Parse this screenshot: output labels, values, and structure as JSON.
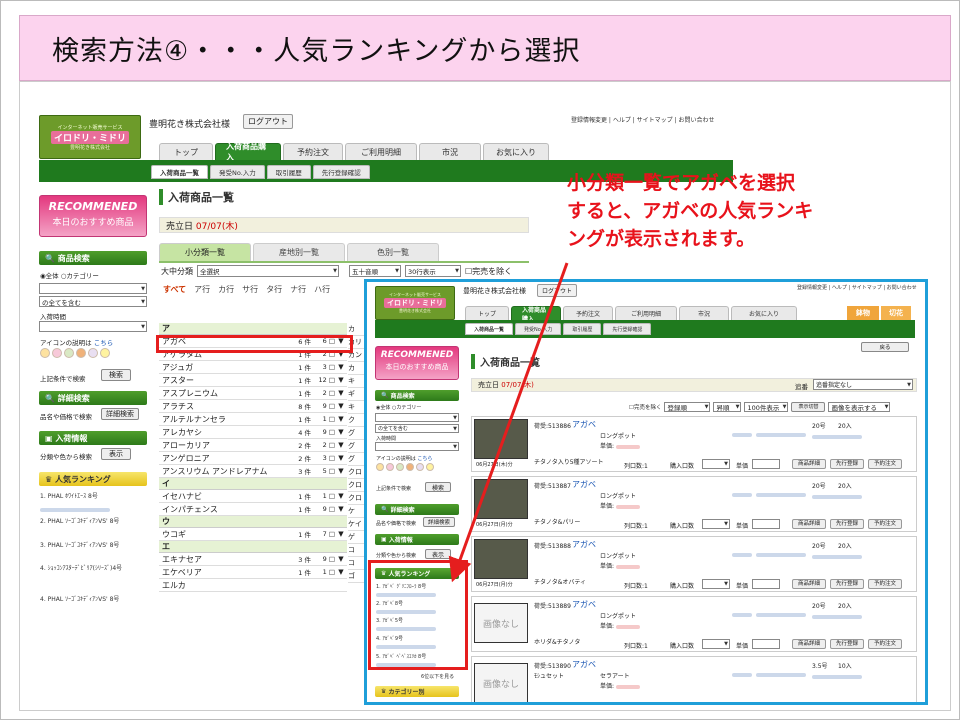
{
  "slide": {
    "title": "検索方法④・・・人気ランキングから選択"
  },
  "callout": {
    "text": "小分類一覧でアガベを選択\nすると、アガベの人気ランキ\nングが表示されます。"
  },
  "shot1": {
    "logo": {
      "line1": "インターネット販売サービス",
      "line2": "イロドリ・ミドリ",
      "line3": "豊明花き株式会社"
    },
    "company": "豊明花き株式会社様",
    "logout": "ログアウト",
    "toplinks": "登録情報変更 | ヘルプ | サイトマップ | お問い合わせ",
    "tabs": [
      "トップ",
      "入荷商品購入",
      "予約注文",
      "ご利用明細",
      "市況",
      "お気に入り"
    ],
    "subtabs": [
      "入荷商品一覧",
      "発受No.入力",
      "取引履歴",
      "先行登録確認"
    ],
    "recommend": {
      "title": "RECOMMENED",
      "sub": "本日のおすすめ商品"
    },
    "search": {
      "header": "商品検索",
      "radio_all": "全体",
      "radio_cat": "カテゴリー",
      "contains": "の全てを含む",
      "time_label": "入荷時間",
      "icon_help": "アイコンの説明は",
      "icon_help_link": "こちら",
      "search_label": "上記条件で検索",
      "search_btn": "検索"
    },
    "detail": {
      "header": "詳細検索",
      "label": "品名や価格で検索",
      "btn": "詳細検索"
    },
    "arrival": {
      "header": "入荷情報",
      "label": "分類や色から検索",
      "btn": "表示"
    },
    "ranking": {
      "header": "人気ランキング",
      "items": [
        "1. PHAL ﾎﾜｲﾄｴｰｽ 8号",
        "2. PHAL ｿｰｺﾞﾕｷﾃﾞｨｱﾝVS' 8号",
        "3. PHAL ｿｰｺﾞﾕｷﾃﾞｨｱﾝVS' 8号",
        "4. ｼｮｯｺﾝｱｽﾀｰﾃﾞﾋﾞﾘｱ(ｼﾘｰｽﾞ)4号",
        "4. PHAL ｿｰｺﾞﾕｷﾃﾞｨｱﾝVS' 8号"
      ]
    },
    "main": {
      "heading": "入荷商品一覧",
      "date_label": "売立日",
      "date_value": "07/07(木)",
      "inner_tabs": [
        "小分類一覧",
        "産地別一覧",
        "色別一覧"
      ],
      "filter_label": "大中分類",
      "filter_value": "全選択",
      "sort_value": "五十音順",
      "rows_value": "30行表示",
      "sold_out": "完売を除く",
      "kana": [
        "すべて",
        "ア行",
        "カ行",
        "サ行",
        "タ行",
        "ナ行",
        "ハ行"
      ],
      "groups": [
        {
          "head": "ア",
          "rows": [
            {
              "name": "アガベ",
              "count": "6 件",
              "sc": "6 □"
            },
            {
              "name": "アゲラタム",
              "count": "1 件",
              "sc": "2 □"
            },
            {
              "name": "アジュガ",
              "count": "1 件",
              "sc": "3 □"
            },
            {
              "name": "アスター",
              "count": "1 件",
              "sc": "12 □"
            },
            {
              "name": "アスプレニウム",
              "count": "1 件",
              "sc": "2 □"
            },
            {
              "name": "アラチス",
              "count": "8 件",
              "sc": "9 □"
            },
            {
              "name": "アルテルナンセラ",
              "count": "1 件",
              "sc": "1 □"
            },
            {
              "name": "アレカヤシ",
              "count": "4 件",
              "sc": "9 □"
            },
            {
              "name": "アローカリア",
              "count": "2 件",
              "sc": "2 □"
            },
            {
              "name": "アンゲロニア",
              "count": "2 件",
              "sc": "3 □"
            },
            {
              "name": "アンスリウム アンドレアナム",
              "count": "3 件",
              "sc": "5 □"
            }
          ]
        },
        {
          "head": "イ",
          "rows": [
            {
              "name": "イセハナビ",
              "count": "1 件",
              "sc": "1 □"
            },
            {
              "name": "インパチェンス",
              "count": "1 件",
              "sc": "9 □"
            }
          ]
        },
        {
          "head": "ウ",
          "rows": [
            {
              "name": "ウコギ",
              "count": "1 件",
              "sc": "7 □"
            }
          ]
        },
        {
          "head": "エ",
          "rows": [
            {
              "name": "エキナセア",
              "count": "3 件",
              "sc": "9 □"
            },
            {
              "name": "エケベリア",
              "count": "1 件",
              "sc": "1 □"
            },
            {
              "name": "エルカ",
              "count": "",
              "sc": ""
            }
          ]
        }
      ],
      "right_col": [
        "カ",
        "カリ",
        "カン",
        "カ",
        "キ",
        "ギ",
        "キ",
        "ク",
        "グ",
        "グ",
        "グ",
        "クロ",
        "クロ",
        "クロ",
        "ケ",
        "ケイ",
        "ゲ",
        "コ",
        "コ",
        "ゴ"
      ]
    }
  },
  "shot2": {
    "logo": {
      "line1": "インターネット販売サービス",
      "line2": "イロドリ・ミドリ",
      "line3": "豊明花き株式会社"
    },
    "company": "豊明花き株式会社様",
    "logout": "ログアウト",
    "toplinks": "登録情報変更 | ヘルプ | サイトマップ | お問い合わせ",
    "tabs": [
      "トップ",
      "入荷商品購入",
      "予約注文",
      "ご利用明細",
      "市況",
      "お気に入り"
    ],
    "tag_orange": "鉢物",
    "tag_green": "切花",
    "subtabs": [
      "入荷商品一覧",
      "発受No.入力",
      "取引履歴",
      "先行登録確認"
    ],
    "recommend": {
      "title": "RECOMMENED",
      "sub": "本日のおすすめ商品"
    },
    "search": {
      "header": "商品検索",
      "radio_all": "全体",
      "radio_cat": "カテゴリー",
      "contains": "の全てを含む",
      "time_label": "入荷時間",
      "icon_help": "アイコンの説明は",
      "icon_help_link": "こちら",
      "search_label": "上記条件で検索",
      "search_btn": "検索"
    },
    "detail": {
      "header": "詳細検索",
      "label": "品名や価格で検索",
      "btn": "詳細検索"
    },
    "arrival": {
      "header": "入荷情報",
      "label": "分類や色から検索",
      "btn": "表示"
    },
    "ranking": {
      "header": "人気ランキング",
      "items": [
        "1. ｱｶﾞﾍﾞ ｸﾞﾘﾆﾌﾛｰﾗ 8号",
        "2. ｱｶﾞﾍﾞ8号",
        "3. ｱｶﾞﾍﾞ5号",
        "4. ｱｶﾞﾍﾞ9号",
        "5. ｱｶﾞﾍﾞ ﾍﾞﾍﾞｽｴﾘｶ 8号"
      ],
      "more": "6位以下を見る"
    },
    "category": "カテゴリー別",
    "main": {
      "heading": "入荷商品一覧",
      "back": "戻る",
      "date_label": "売立日",
      "date_value": "07/07(木)",
      "append_label": "追番",
      "append_value": "追番指定なし",
      "sold_out": "完売を除く",
      "sort1": "登録順",
      "sort2": "昇順",
      "rows_value": "100件表示",
      "switch_btn": "表示切替",
      "image_value": "画像を表示する",
      "products": [
        {
          "code": "荷受:513886",
          "name": "アガベ",
          "sub": "ロングポット",
          "price_label": "単価:",
          "variety": "チタノタ入り5種アソート",
          "date": "06月27日(木)分",
          "size": "20号",
          "qty": "20入",
          "stock": "列口数:1",
          "buy": "購入口数",
          "unit": "単価",
          "has_image": true
        },
        {
          "code": "荷受:513887",
          "name": "アガベ",
          "sub": "ロングポット",
          "price_label": "単価:",
          "variety": "チタノタ&パリー",
          "date": "06月27日(月)分",
          "size": "20号",
          "qty": "20入",
          "stock": "列口数:1",
          "buy": "購入口数",
          "unit": "単価",
          "has_image": true
        },
        {
          "code": "荷受:513888",
          "name": "アガベ",
          "sub": "ロングポット",
          "price_label": "単価:",
          "variety": "チタノタ&オバティ",
          "date": "06月27日(月)分",
          "size": "20号",
          "qty": "20入",
          "stock": "列口数:1",
          "buy": "購入口数",
          "unit": "単価",
          "has_image": true
        },
        {
          "code": "荷受:513889",
          "name": "アガベ",
          "sub": "ロングポット",
          "price_label": "単価:",
          "variety": "ホリダ&チタノタ",
          "date": "",
          "size": "20号",
          "qty": "20入",
          "stock": "列口数:1",
          "buy": "購入口数",
          "unit": "単価",
          "has_image": false,
          "no_image": "画像なし"
        },
        {
          "code": "荷受:513890",
          "name": "アガベ",
          "sub": "セラアート",
          "sub2": "ﾓｼュセット",
          "price_label": "単価:",
          "variety": "",
          "date": "",
          "size": "3.5号",
          "qty": "10入",
          "stock": "",
          "buy": "",
          "unit": "",
          "has_image": false,
          "no_image": "画像なし"
        }
      ],
      "btn_detail": "商品詳細",
      "btn_pre": "先行登録",
      "btn_reserve": "予約注文"
    }
  }
}
